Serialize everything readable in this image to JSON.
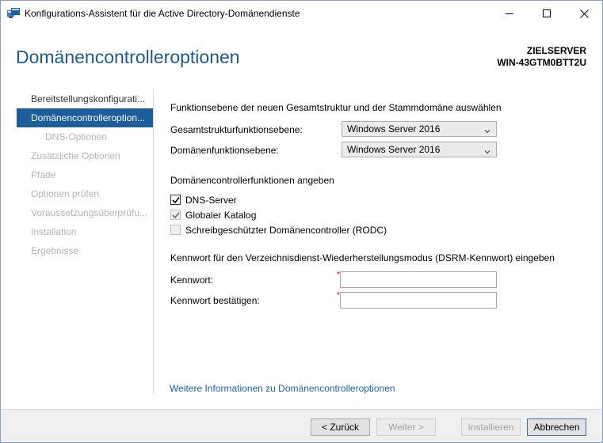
{
  "window": {
    "title": "Konfigurations-Assistent für die Active Directory-Domänendienste",
    "controls": [
      "minimize-icon",
      "maximize-icon",
      "close-icon"
    ]
  },
  "header": {
    "page_title": "Domänencontrolleroptionen",
    "target_label": "ZIELSERVER",
    "target_server": "WIN-43GTM0BTT2U"
  },
  "sidebar": {
    "items": [
      {
        "label": "Bereitstellungskonfigurati...",
        "state": "done"
      },
      {
        "label": "Domänencontrolleroption...",
        "state": "active"
      },
      {
        "label": "DNS-Optionen",
        "state": "disabled"
      },
      {
        "label": "Zusätzliche Optionen",
        "state": "disabled"
      },
      {
        "label": "Pfade",
        "state": "disabled"
      },
      {
        "label": "Optionen prüfen",
        "state": "disabled"
      },
      {
        "label": "Voraussetzungsüberprüfu...",
        "state": "disabled"
      },
      {
        "label": "Installation",
        "state": "disabled"
      },
      {
        "label": "Ergebnisse",
        "state": "disabled"
      }
    ]
  },
  "main": {
    "functional_levels_heading": "Funktionsebene der neuen Gesamtstruktur und der Stammdomäne auswählen",
    "forest_level_label": "Gesamtstrukturfunktionsebene:",
    "forest_level_value": "Windows Server 2016",
    "domain_level_label": "Domänenfunktionsebene:",
    "domain_level_value": "Windows Server 2016",
    "dc_functions_heading": "Domänencontrollerfunktionen angeben",
    "checkboxes": [
      {
        "label": "DNS-Server",
        "checked": true,
        "enabled": true
      },
      {
        "label": "Globaler Katalog",
        "checked": true,
        "enabled": false
      },
      {
        "label": "Schreibgeschützter Domänencontroller (RODC)",
        "checked": false,
        "enabled": false
      }
    ],
    "dsrm_heading": "Kennwort für den Verzeichnisdienst-Wiederherstellungsmodus (DSRM-Kennwort) eingeben",
    "password_label": "Kennwort:",
    "password_value": "",
    "confirm_label": "Kennwort bestätigen:",
    "confirm_value": "",
    "required_marker": "*",
    "more_info_link": "Weitere Informationen zu Domänencontrolleroptionen"
  },
  "footer": {
    "back_label": "< Zurück",
    "next_label": "Weiter >",
    "install_label": "Installieren",
    "cancel_label": "Abbrechen"
  },
  "colors": {
    "accent": "#1c5e9d",
    "title_blue": "#1e5a8a",
    "link": "#1a63b0",
    "required": "#d40000"
  }
}
